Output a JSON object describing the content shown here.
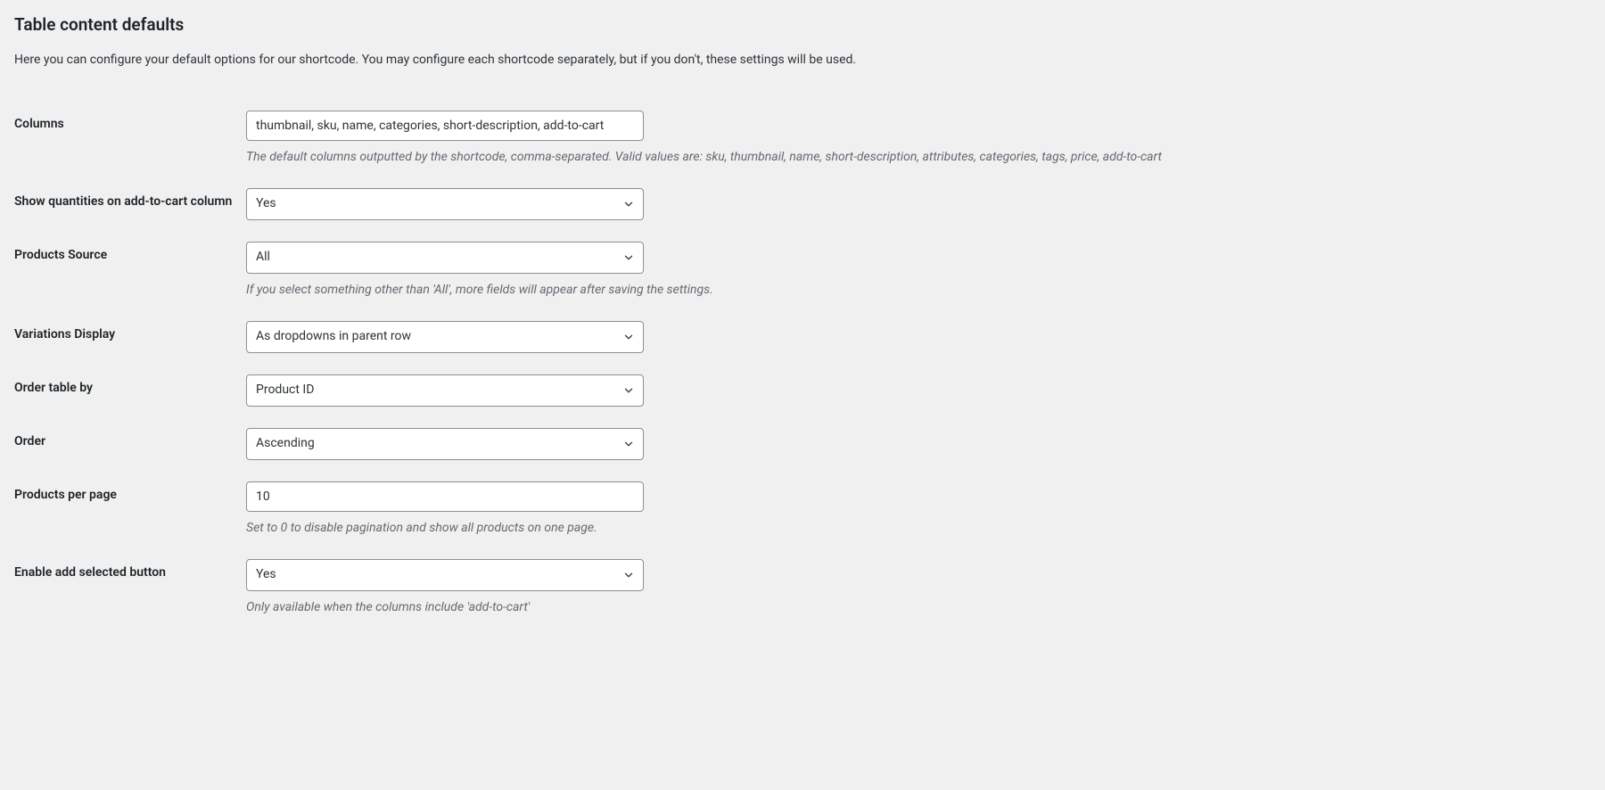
{
  "section": {
    "title": "Table content defaults",
    "description": "Here you can configure your default options for our shortcode. You may configure each shortcode separately, but if you don't, these settings will be used."
  },
  "fields": {
    "columns": {
      "label": "Columns",
      "value": "thumbnail, sku, name, categories, short-description, add-to-cart",
      "help": "The default columns outputted by the shortcode, comma-separated. Valid values are: sku, thumbnail, name, short-description, attributes, categories, tags, price, add-to-cart"
    },
    "show_quantities": {
      "label": "Show quantities on add-to-cart column",
      "value": "Yes"
    },
    "products_source": {
      "label": "Products Source",
      "value": "All",
      "help": "If you select something other than 'All', more fields will appear after saving the settings."
    },
    "variations_display": {
      "label": "Variations Display",
      "value": "As dropdowns in parent row"
    },
    "order_by": {
      "label": "Order table by",
      "value": "Product ID"
    },
    "order": {
      "label": "Order",
      "value": "Ascending"
    },
    "products_per_page": {
      "label": "Products per page",
      "value": "10",
      "help": "Set to 0 to disable pagination and show all products on one page."
    },
    "enable_add_selected": {
      "label": "Enable add selected button",
      "value": "Yes",
      "help": "Only available when the columns include 'add-to-cart'"
    }
  }
}
